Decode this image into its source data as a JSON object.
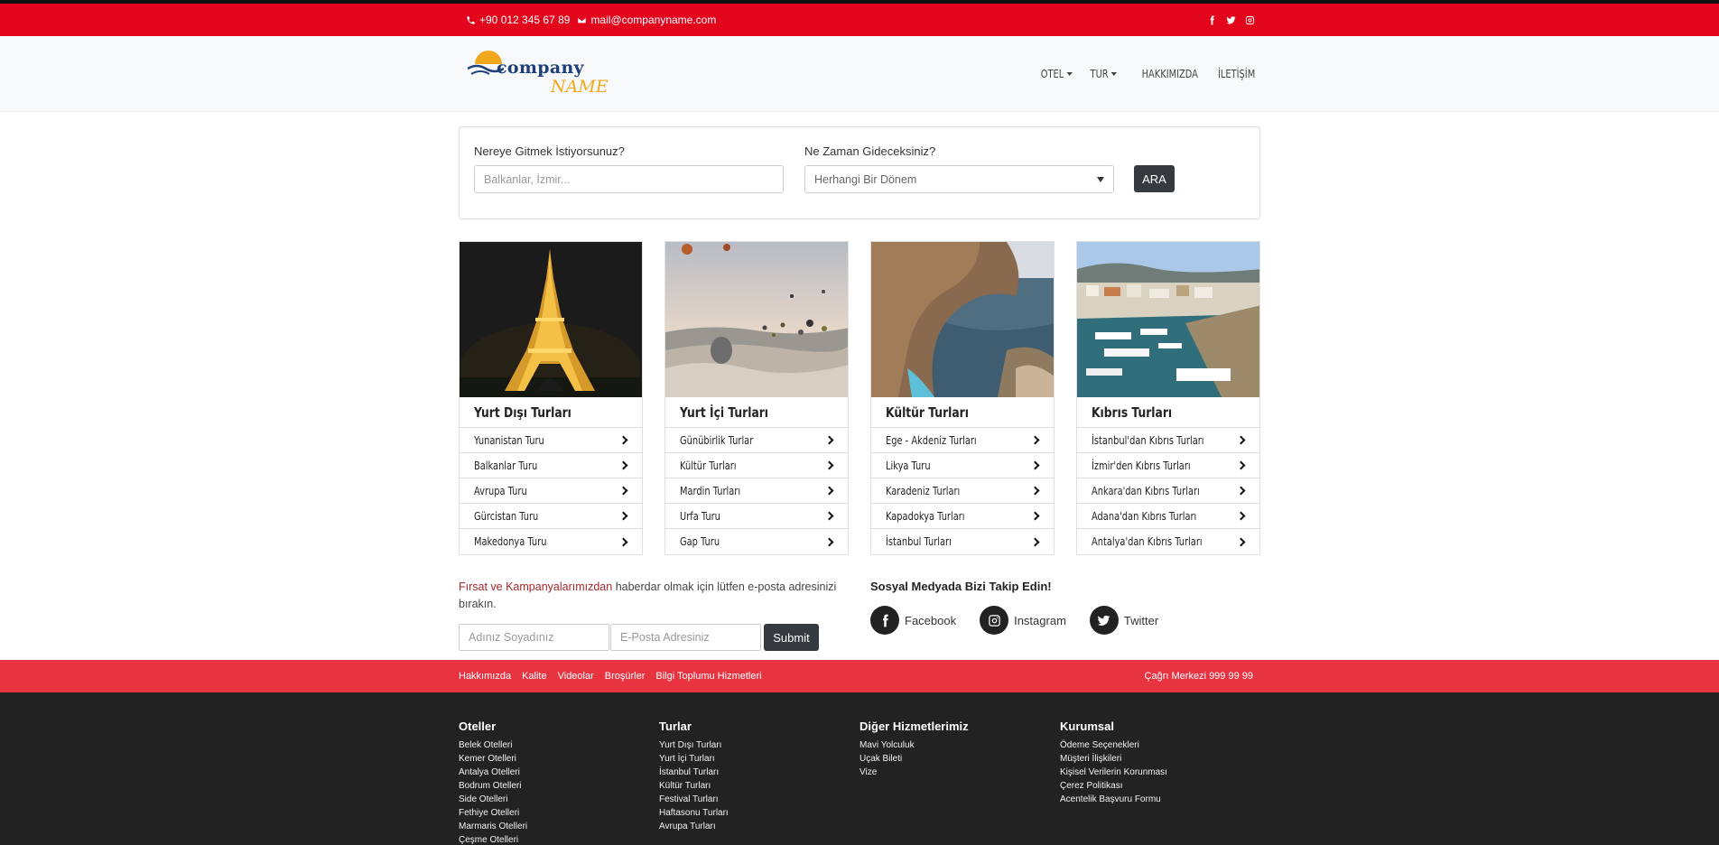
{
  "topbar": {
    "phone": "+90 012 345 67 89",
    "email": "mail@companyname.com",
    "social_icons": [
      "facebook-icon",
      "twitter-icon",
      "instagram-icon"
    ]
  },
  "logo": {
    "line1": "company",
    "line2": "NAME"
  },
  "nav": [
    {
      "label": "OTEL",
      "dropdown": true
    },
    {
      "label": "TUR",
      "dropdown": true
    },
    {
      "label": "HAKKIMIZDA",
      "dropdown": false
    },
    {
      "label": "İLETİŞİM",
      "dropdown": false
    }
  ],
  "search": {
    "where_label": "Nereye Gitmek İstiyorsunuz?",
    "where_placeholder": "Balkanlar, İzmir...",
    "when_label": "Ne Zaman Gideceksiniz?",
    "when_selected": "Herhangi Bir Dönem",
    "button": "ARA"
  },
  "cards": [
    {
      "title": "Yurt Dışı Turları",
      "image": "eiffel-tower-night",
      "items": [
        "Yunanistan Turu",
        "Balkanlar Turu",
        "Avrupa Turu",
        "Gürcistan Turu",
        "Makedonya Turu"
      ]
    },
    {
      "title": "Yurt İçi Turları",
      "image": "hot-air-balloons",
      "items": [
        "Günübirlik Turlar",
        "Kültür Turları",
        "Mardin Turları",
        "Urfa Turu",
        "Gap Turu"
      ]
    },
    {
      "title": "Kültür Turları",
      "image": "coastal-cliff",
      "items": [
        "Ege - Akdeniz Turları",
        "Likya Turu",
        "Karadeniz Turları",
        "Kapadokya Turları",
        "İstanbul Turları"
      ]
    },
    {
      "title": "Kıbrıs Turları",
      "image": "harbor-boats",
      "items": [
        "İstanbul'dan Kıbrıs Turları",
        "İzmir'den Kıbrıs Turları",
        "Ankara'dan Kıbrıs Turları",
        "Adana'dan Kıbrıs Turları",
        "Antalya'dan Kıbrıs Turları"
      ]
    }
  ],
  "newsletter": {
    "highlight": "Fırsat ve Kampanyalarımızdan",
    "text": " haberdar olmak için lütfen e-posta adresinizi bırakın.",
    "name_placeholder": "Adınız Soyadınız",
    "email_placeholder": "E-Posta Adresiniz",
    "submit": "Submit"
  },
  "social": {
    "heading": "Sosyal Medyada Bizi Takip Edin!",
    "links": [
      {
        "label": "Facebook",
        "icon": "facebook-icon"
      },
      {
        "label": "Instagram",
        "icon": "instagram-icon"
      },
      {
        "label": "Twitter",
        "icon": "twitter-icon"
      }
    ]
  },
  "footer_bar": {
    "links": [
      "Hakkımızda",
      "Kalite",
      "Videolar",
      "Broşürler",
      "Bilgi Toplumu Hizmetleri"
    ],
    "call_center": "Çağrı Merkezi 999 99 99"
  },
  "footer": [
    {
      "title": "Oteller",
      "items": [
        "Belek Otelleri",
        "Kemer Otelleri",
        "Antalya Otelleri",
        "Bodrum Otelleri",
        "Side Otelleri",
        "Fethiye Otelleri",
        "Marmaris Otelleri",
        "Çeşme Otelleri"
      ]
    },
    {
      "title": "Turlar",
      "items": [
        "Yurt Dışı Turları",
        "Yurt İçi Turları",
        "İstanbul Turları",
        "Kültür Turları",
        "Festival Turları",
        "Haftasonu Turları",
        "Avrupa Turları"
      ]
    },
    {
      "title": "Diğer Hizmetlerimiz",
      "items": [
        "Mavi Yolculuk",
        "Uçak Bileti",
        "Vize"
      ]
    },
    {
      "title": "Kurumsal",
      "items": [
        "Ödeme Seçenekleri",
        "Müşteri İlişkileri",
        "Kişisel Verilerin Korunması",
        "Çerez Politikası",
        "Acentelik Başvuru Formu"
      ]
    }
  ],
  "colors": {
    "topbar": "#e3051b",
    "footer_bar": "#e83341",
    "footer": "#222222",
    "button": "#343a40",
    "logo_blue": "#1f3f7a",
    "logo_orange": "#f2a81d"
  }
}
